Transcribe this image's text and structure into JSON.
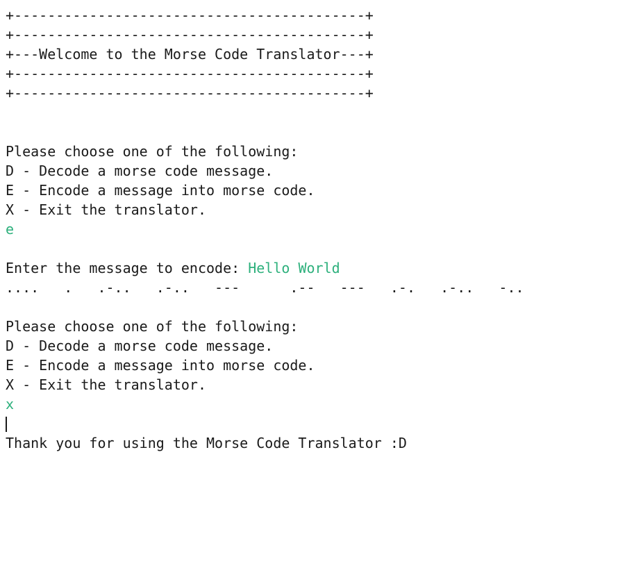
{
  "banner": {
    "border": "+------------------------------------------+",
    "title": "+---Welcome to the Morse Code Translator---+"
  },
  "menu": {
    "prompt": "Please choose one of the following:",
    "options": [
      "D - Decode a morse code message.",
      "E - Encode a message into morse code.",
      "X - Exit the translator."
    ]
  },
  "session": {
    "choice1": "e",
    "choice2": "x"
  },
  "encode": {
    "prompt": "Enter the message to encode: ",
    "message": "Hello World",
    "morse_output": "....   .   .-..   .-..   ---      .--   ---   .-.   .-..   -.."
  },
  "exit": {
    "message": "Thank you for using the Morse Code Translator :D"
  }
}
